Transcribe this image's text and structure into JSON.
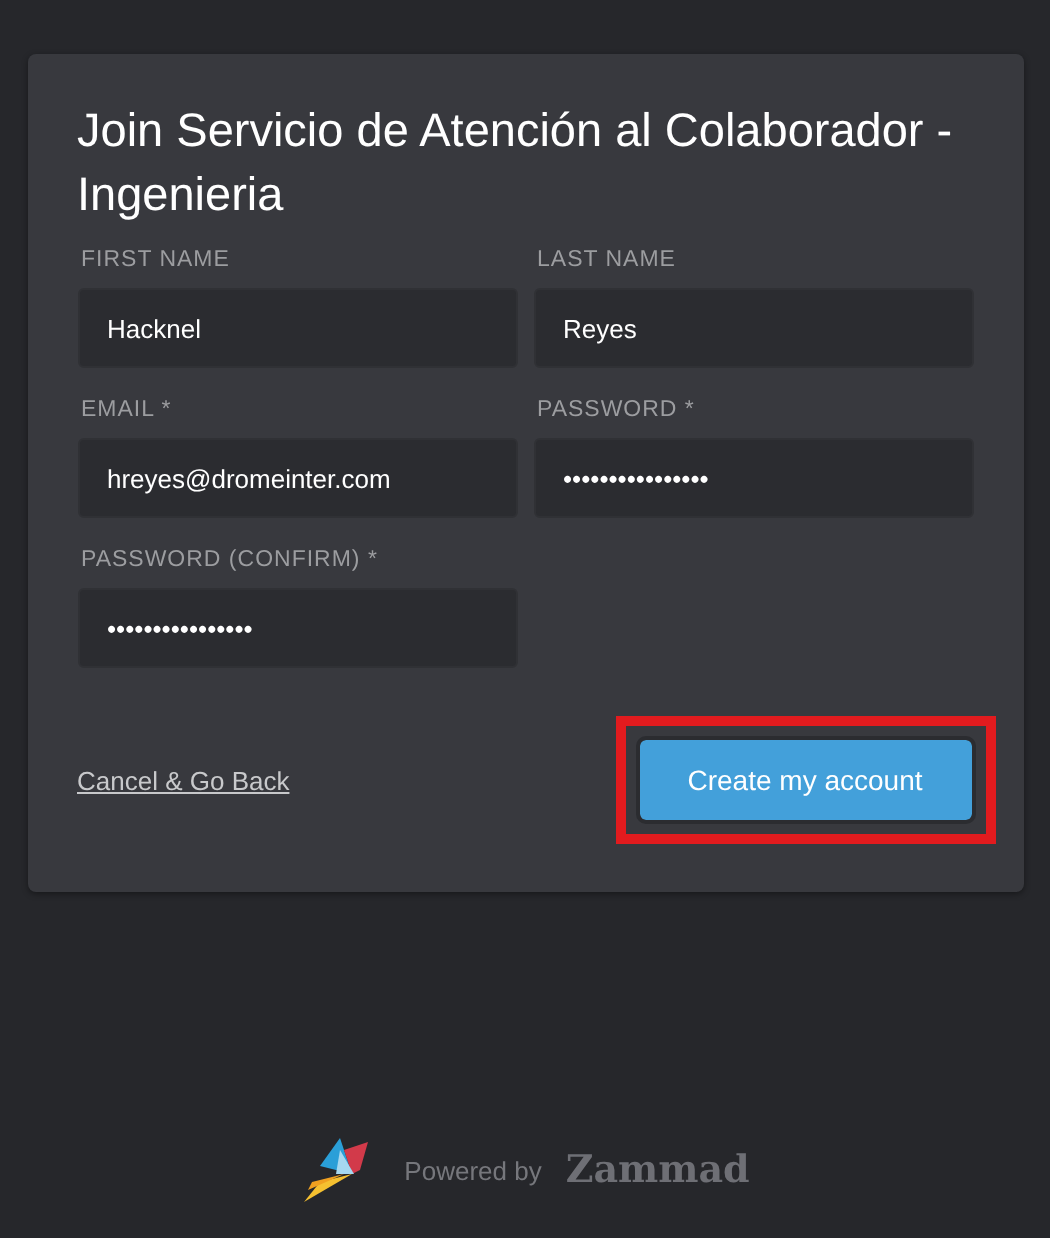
{
  "title": "Join Servicio de Atención al Colaborador - Ingenieria",
  "fields": [
    {
      "label": "FIRST NAME",
      "value": "Hacknel"
    },
    {
      "label": "LAST NAME",
      "value": "Reyes"
    },
    {
      "label": "EMAIL *",
      "value": "hreyes@dromeinter.com"
    },
    {
      "label": "PASSWORD *",
      "value": "••••••••••••••••"
    },
    {
      "label": "PASSWORD (CONFIRM) *",
      "value": "••••••••••••••••"
    }
  ],
  "cancel_link": "Cancel & Go Back",
  "submit_button": {
    "label": "Create my account",
    "highlighted": true
  },
  "footer": {
    "powered_by": "Powered by",
    "brand": "Zammad"
  }
}
